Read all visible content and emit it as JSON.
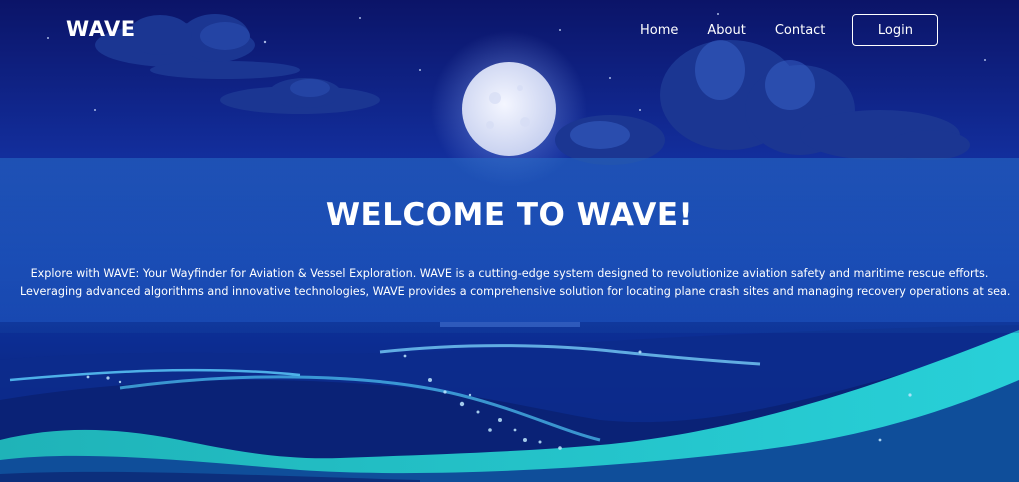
{
  "brand": "WAVE",
  "nav": {
    "home": "Home",
    "about": "About",
    "contact": "Contact",
    "login": "Login"
  },
  "hero": {
    "title": "WELCOME TO WAVE!",
    "line1": "Explore with WAVE: Your Wayfinder for Aviation & Vessel Exploration. WAVE is a cutting-edge system designed to revolutionize aviation safety and maritime rescue efforts.",
    "line2": "Leveraging advanced algorithms and innovative technologies, WAVE provides a comprehensive solution for locating plane crash sites and managing recovery operations at sea."
  },
  "colors": {
    "sky_top": "#0b1a6e",
    "sky_mid": "#1a3ea8",
    "sea": "#0a2a8a",
    "wave_highlight": "#38c8d8",
    "moon": "#e8eefa"
  }
}
